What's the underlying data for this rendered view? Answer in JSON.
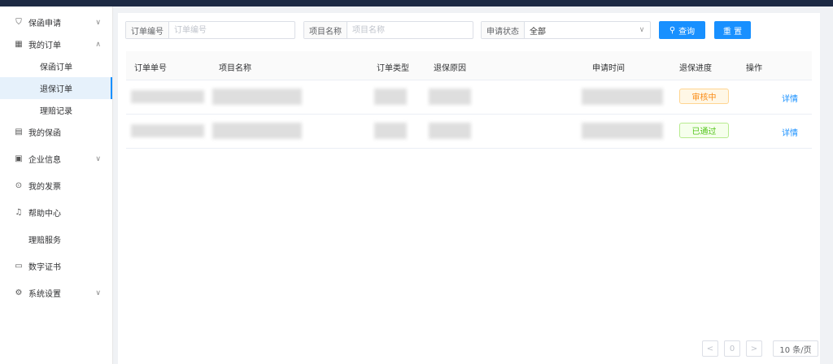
{
  "sidebar": {
    "items": [
      {
        "label": "保函申请",
        "icon": "shield-icon",
        "arrow": "∨"
      },
      {
        "label": "我的订单",
        "icon": "grid-icon",
        "arrow": "∧"
      },
      {
        "label": "我的保函",
        "icon": "document-icon"
      },
      {
        "label": "企业信息",
        "icon": "building-icon",
        "arrow": "∨"
      },
      {
        "label": "我的发票",
        "icon": "invoice-icon"
      },
      {
        "label": "帮助中心",
        "icon": "bell-icon"
      },
      {
        "label": "理赔服务"
      },
      {
        "label": "数字证书",
        "icon": "certificate-icon"
      },
      {
        "label": "系统设置",
        "icon": "gear-icon",
        "arrow": "∨"
      }
    ],
    "subitems": [
      {
        "label": "保函订单"
      },
      {
        "label": "退保订单"
      },
      {
        "label": "理赔记录"
      }
    ]
  },
  "search": {
    "order_no_label": "订单编号",
    "order_no_placeholder": "订单编号",
    "project_label": "项目名称",
    "project_placeholder": "项目名称",
    "status_label": "申请状态",
    "status_value": "全部",
    "query_label": "查询",
    "reset_label": "重 置"
  },
  "table": {
    "columns": [
      "订单单号",
      "项目名称",
      "订单类型",
      "退保原因",
      "申请时间",
      "退保进度",
      "操作"
    ],
    "rows": [
      {
        "progress": "审核中",
        "action": "详情"
      },
      {
        "progress": "已通过",
        "action": "详情"
      }
    ]
  },
  "pagination": {
    "prev": "<",
    "page": "0",
    "next": ">",
    "page_size": "10 条/页"
  },
  "colors": {
    "accent": "#1890ff",
    "topbar": "#1d2a44",
    "warning": "#fa8c16",
    "success": "#52c41a"
  }
}
